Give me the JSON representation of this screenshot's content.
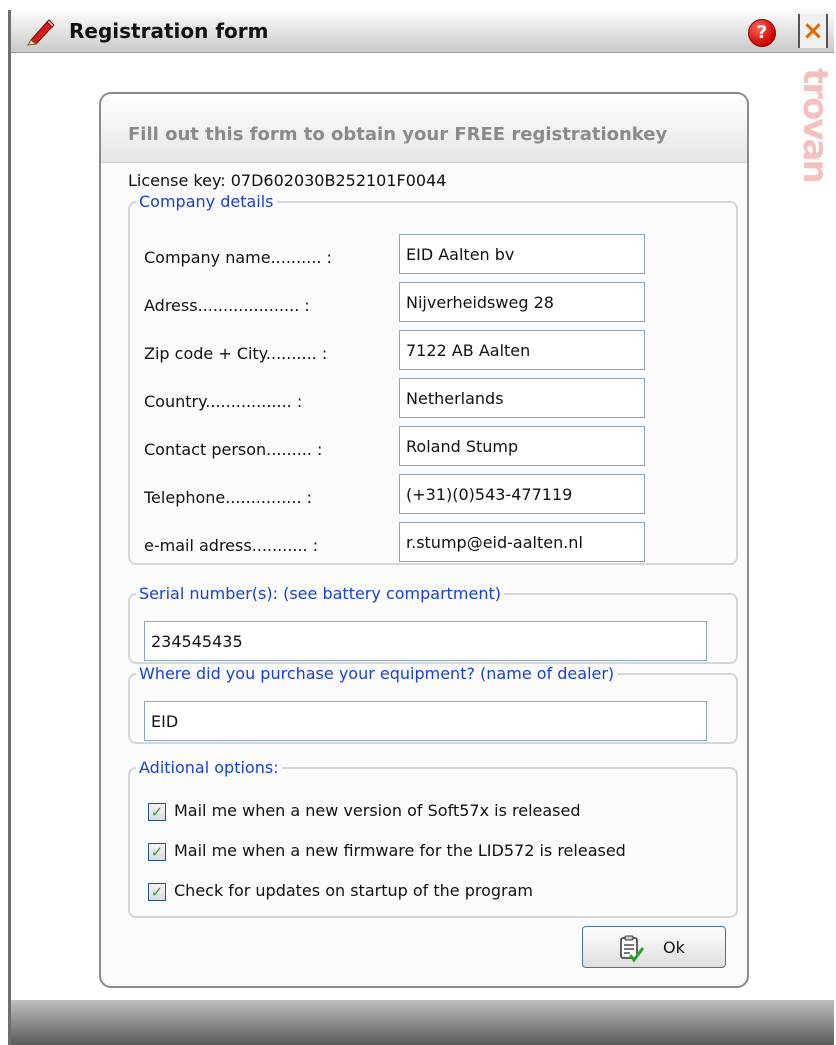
{
  "window": {
    "title": "Registration form",
    "help_glyph": "?",
    "close_glyph": "×",
    "watermark": "trovan"
  },
  "panel": {
    "header": "Fill out this form to obtain your FREE registrationkey",
    "license": "License key: 07D602030B252101F0044"
  },
  "company": {
    "legend": "Company details",
    "rows": [
      {
        "label": "Company name.......... :",
        "value": "EID Aalten bv"
      },
      {
        "label": "Adress.................... :",
        "value": "Nijverheidsweg 28"
      },
      {
        "label": "Zip code + City.......... :",
        "value": "7122 AB Aalten"
      },
      {
        "label": "Country................. :",
        "value": "Netherlands"
      },
      {
        "label": "Contact person......... :",
        "value": "Roland Stump"
      },
      {
        "label": "Telephone............... :",
        "value": "(+31)(0)543-477119"
      },
      {
        "label": "e-mail adress........... :",
        "value": "r.stump@eid-aalten.nl"
      }
    ]
  },
  "serial": {
    "legend": "Serial number(s): (see battery compartment)",
    "value": "234545435"
  },
  "dealer": {
    "legend": "Where did you purchase your equipment? (name of dealer)",
    "value": "EID"
  },
  "options": {
    "legend": "Aditional options:",
    "items": [
      {
        "label": "Mail me when a new version of Soft57x is released",
        "checked": true
      },
      {
        "label": "Mail me when a new firmware for the LID572 is released",
        "checked": true
      },
      {
        "label": "Check for updates on startup of the program",
        "checked": true
      }
    ],
    "check_glyph": "✓"
  },
  "ok_button": {
    "label": "Ok"
  },
  "colors": {
    "legend_text": "#1a3ed8",
    "field_border": "#8aa4c4",
    "check_green": "#2ba02b",
    "close_orange": "#e06a00",
    "help_red": "#c80000"
  },
  "icons": {
    "title": "pencil-icon",
    "help": "help-icon",
    "close": "close-icon",
    "ok": "clipboard-check-icon"
  }
}
